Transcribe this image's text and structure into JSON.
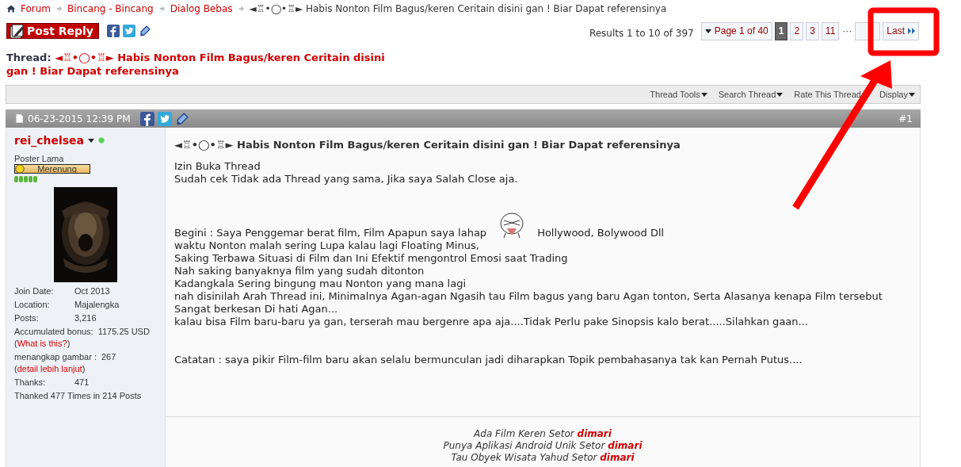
{
  "breadcrumb": {
    "items": [
      {
        "label": "Forum"
      },
      {
        "label": "Bincang - Bincang"
      },
      {
        "label": "Dialog Bebas"
      }
    ],
    "current": "◄♖•◯•♖► Habis Nonton Film Bagus/keren Ceritain disini gan ! Biar Dapat referensinya"
  },
  "post_reply": "Post Reply",
  "results": "Results 1 to 10 of 397",
  "pagination": {
    "page_menu": "Page 1 of 40",
    "pages": [
      {
        "label": "1",
        "selected": true
      },
      {
        "label": "2",
        "selected": false
      },
      {
        "label": "3",
        "selected": false
      },
      {
        "label": "11",
        "selected": false
      }
    ],
    "ellipsis": "···",
    "last": "Last"
  },
  "thread_title": {
    "prefix": "Thread:",
    "title": "◄♖•◯•♖► Habis Nonton Film Bagus/keren Ceritain disini gan ! Biar Dapat referensinya"
  },
  "tools": [
    "Thread Tools",
    "Search Thread",
    "Rate This Thread",
    "Display"
  ],
  "post": {
    "date": "06-23-2015 12:39 PM",
    "number": "#1",
    "user": {
      "name": "rei_chelsea",
      "online": true,
      "title": "Poster Lama",
      "rank": "Merenung",
      "stars": 5,
      "details": [
        {
          "label": "Join Date:",
          "value": "Oct 2013"
        },
        {
          "label": "Location:",
          "value": "Majalengka"
        },
        {
          "label": "Posts:",
          "value": "3,216"
        },
        {
          "label": "Accumulated bonus:",
          "value": "1175.25 USD",
          "link_before": "(",
          "link": "What is this?",
          "link_after": ")"
        },
        {
          "label": "menangkap gambar :",
          "value": "267",
          "link_before": "(",
          "link": "detail lebih lanjut",
          "link_after": ")"
        },
        {
          "label": "Thanks:",
          "value": "471"
        }
      ],
      "thanked": "Thanked 477 Times in 214 Posts"
    },
    "title": "◄♖•◯•♖► Habis Nonton Film Bagus/keren Ceritain disini gan ! Biar Dapat referensinya",
    "body": [
      {
        "kind": "text",
        "text": "Izin Buka Thread"
      },
      {
        "kind": "text",
        "text": "Sudah cek Tidak ada Thread yang sama, Jika saya Salah Close aja."
      },
      {
        "kind": "blank"
      },
      {
        "kind": "emoticon",
        "text": "Begini : Saya Penggemar berat film, Film Apapun saya lahap",
        "after": "Hollywood, Bolywood Dll"
      },
      {
        "kind": "text",
        "text": "waktu Nonton malah sering Lupa kalau lagi Floating Minus,"
      },
      {
        "kind": "text",
        "text": "Saking Terbawa Situasi di Film dan Ini Efektif mengontrol Emosi saat Trading"
      },
      {
        "kind": "text",
        "text": "Nah saking banyaknya film yang sudah ditonton"
      },
      {
        "kind": "text",
        "text": "Kadangkala Sering bingung mau Nonton yang mana lagi"
      },
      {
        "kind": "text",
        "text": "nah disinilah Arah Thread ini, Minimalnya Agan-agan Ngasih tau Film bagus yang baru Agan tonton, Serta Alasanya kenapa Film tersebut Sangat berkesan Di hati Agan..."
      },
      {
        "kind": "text",
        "text": "kalau bisa Film baru-baru ya gan, terserah mau bergenre apa aja....Tidak Perlu pake Sinopsis kalo berat.....Silahkan gaan..."
      },
      {
        "kind": "blank"
      },
      {
        "kind": "text",
        "text": "Catatan : saya pikir Film-film baru akan selalu bermunculan jadi diharapkan Topik pembahasanya tak kan Pernah Putus...."
      }
    ],
    "signature": [
      "Ada Film Keren Setor **dimari**",
      "Punya Aplikasi Android Unik Setor **dimari**",
      "Tau Obyek Wisata Yahud Setor **dimari**"
    ]
  }
}
